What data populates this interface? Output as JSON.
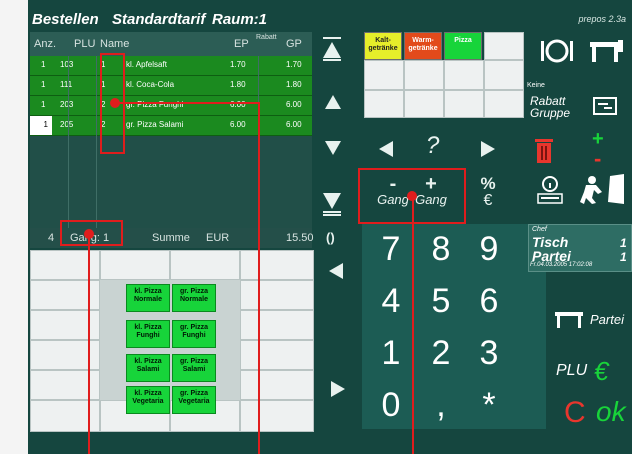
{
  "titlebar": {
    "mode": "Bestellen",
    "tariff": "Standardtarif",
    "room": "Raum:1",
    "version": "prepos 2.3a"
  },
  "table": {
    "headers": {
      "anz": "Anz.",
      "plu": "PLU",
      "name": "Name",
      "ep": "EP",
      "rabatt": "Rabatt",
      "gp": "GP"
    },
    "rows": [
      {
        "anz": "1",
        "plu": "103",
        "gang": "1",
        "name": "kl. Apfelsaft",
        "ep": "1.70",
        "gp": "1.70"
      },
      {
        "anz": "1",
        "plu": "111",
        "gang": "1",
        "name": "kl. Coca-Cola",
        "ep": "1.80",
        "gp": "1.80"
      },
      {
        "anz": "1",
        "plu": "203",
        "gang": "2",
        "name": "gr. Pizza Funghi",
        "ep": "6.00",
        "gp": "6.00"
      },
      {
        "anz": "1",
        "plu": "205",
        "gang": "2",
        "name": "gr. Pizza Salami",
        "ep": "6.00",
        "gp": "6.00"
      }
    ],
    "summary": {
      "count": "4",
      "gang": "Gang: 1",
      "label": "Summe",
      "currency": "EUR",
      "total": "15.50"
    }
  },
  "products": [
    {
      "label": "kl. Pizza Normale"
    },
    {
      "label": "gr. Pizza Normale"
    },
    {
      "label": "kl. Pizza Funghi"
    },
    {
      "label": "gr. Pizza Funghi"
    },
    {
      "label": "kl. Pizza Salami"
    },
    {
      "label": "gr. Pizza Salami"
    },
    {
      "label": "kl. Pizza Vegetaria"
    },
    {
      "label": "gr. Pizza Vegetaria"
    }
  ],
  "categories": [
    {
      "label": "Kalt-getränke",
      "color": "#e6ee2a"
    },
    {
      "label": "Warm-getränke",
      "color": "#e24a1b"
    },
    {
      "label": "Pizza",
      "color": "#17d43a"
    }
  ],
  "controls": {
    "gang_minus": "-",
    "gang_plus": "+",
    "gang_label": "Gang",
    "percent": "%",
    "euro": "€",
    "question": "?",
    "paren": "()"
  },
  "keypad": [
    "7",
    "8",
    "9",
    "4",
    "5",
    "6",
    "1",
    "2",
    "3",
    "0",
    ",",
    "*"
  ],
  "right": {
    "rabatt_top": "Keine",
    "rabatt_1": "Rabatt",
    "rabatt_2": "Gruppe",
    "plus": "+",
    "minus": "-",
    "chef": "Chef",
    "tisch_label": "Tisch",
    "tisch_value": "1",
    "partei_label": "Partei",
    "partei_value": "1",
    "datetime": "Fr.04.03.2005 17:02:08",
    "partei_button": "Partei",
    "plu": "PLU",
    "euro": "€",
    "cancel": "C",
    "ok": "ok"
  }
}
